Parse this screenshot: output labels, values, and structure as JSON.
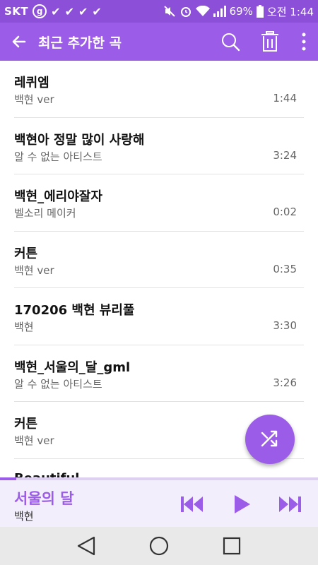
{
  "status_bar": {
    "carrier": "SKT",
    "g_badge": "g",
    "checks": [
      "✔",
      "✔",
      "✔",
      "✔"
    ],
    "battery": "69%",
    "time": "오전 1:44"
  },
  "app_bar": {
    "title": "최근 추가한 곡",
    "icons": [
      "back-arrow-icon",
      "search-icon",
      "trash-icon",
      "more-vert-icon"
    ]
  },
  "songs": [
    {
      "title": "레퀴엠",
      "artist": "백현 ver",
      "duration": "1:44"
    },
    {
      "title": "백현아 정말 많이 사랑해",
      "artist": "알 수 없는 아티스트",
      "duration": "3:24"
    },
    {
      "title": "백현_에리야잘자",
      "artist": "벨소리 메이커",
      "duration": "0:02"
    },
    {
      "title": "커튼",
      "artist": "백현 ver",
      "duration": "0:35"
    },
    {
      "title": "170206 백현 뷰리풀",
      "artist": "백현",
      "duration": "3:30"
    },
    {
      "title": "백현_서울의_달_gml",
      "artist": "알 수 없는 아티스트",
      "duration": "3:26"
    },
    {
      "title": "커튼",
      "artist": "백현 ver",
      "duration": ""
    },
    {
      "title": "Beautiful",
      "artist": "",
      "duration": ""
    }
  ],
  "now_playing": {
    "title": "서울의 달",
    "artist": "백현",
    "progress": 0.05
  },
  "colors": {
    "accent": "#9b5ce8",
    "status_bar": "#8c4fd8",
    "now_playing_bg": "#f3eefb"
  }
}
